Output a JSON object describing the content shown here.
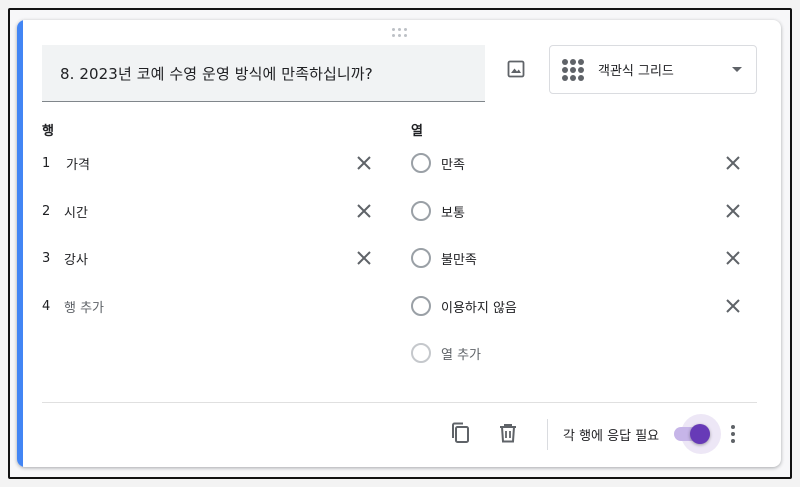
{
  "question": {
    "title": "8. 2023년 코예 수영 운영 방식에 만족하십니까?"
  },
  "type_select": {
    "selected": "객관식 그리드",
    "icon": "grid-dots-icon"
  },
  "rows": {
    "heading": "행",
    "items": [
      {
        "num": "1",
        "label": "가격"
      },
      {
        "num": "2",
        "label": "시간"
      },
      {
        "num": "3",
        "label": "강사"
      }
    ],
    "add": {
      "num": "4",
      "label": "행 추가"
    }
  },
  "columns": {
    "heading": "열",
    "items": [
      {
        "label": "만족"
      },
      {
        "label": "보통"
      },
      {
        "label": "불만족"
      },
      {
        "label": "이용하지 않음"
      }
    ],
    "add": {
      "label": "열 추가"
    }
  },
  "footer": {
    "required_label": "각 행에 응답 필요",
    "required_on": true
  },
  "colors": {
    "accent_bar": "#4285f4",
    "toggle": "#673ab7"
  }
}
